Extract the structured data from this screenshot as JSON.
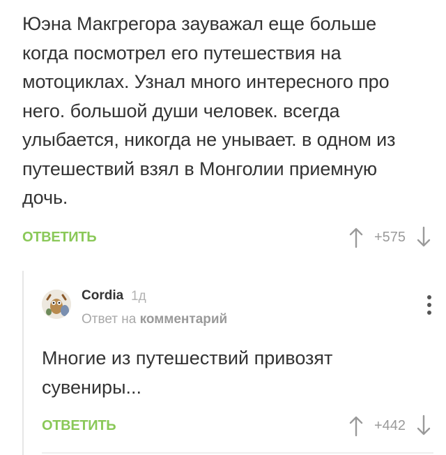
{
  "main_comment": {
    "text": "Юэна Макгрегора зауважал еще больше когда посмотрел его путешествия на мотоциклах. Узнал много интересного про него. большой души человек. всегда улыбается, никогда не унывает. в одном из путешествий взял в Монголии приемную дочь.",
    "reply_label": "ОТВЕТИТЬ",
    "rating": "+575"
  },
  "reply": {
    "author": "Cordia",
    "ago": "1д",
    "reply_to_prefix": "Ответ на",
    "reply_to_target": "комментарий",
    "text": "Многие из путешествий привозят сувениры...",
    "reply_label": "ОТВЕТИТЬ",
    "rating": "+442"
  },
  "icons": {
    "upvote": "arrow-up-icon",
    "downvote": "arrow-down-icon",
    "more": "more-vertical-icon",
    "avatar": "avatar-image"
  },
  "colors": {
    "accent_green": "#8ac858",
    "muted_gray": "#9a9a9a"
  }
}
